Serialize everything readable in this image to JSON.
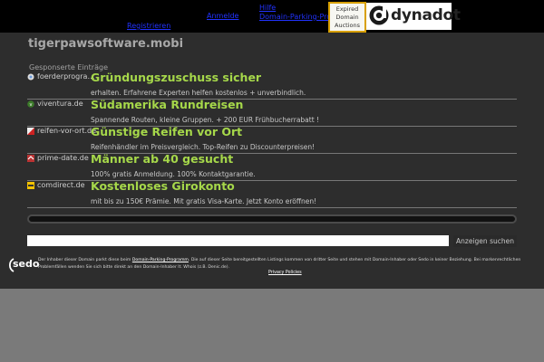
{
  "top": {
    "links": [
      "Registrieren",
      "Anmelde",
      "Hilfe",
      "Domain-Parking-Programm"
    ],
    "expired_box": {
      "line1": "Expired",
      "line2": "Domain",
      "line3": "Auctions"
    },
    "dynadot_text": "dynadot"
  },
  "main": {
    "domain": "tigerpawsoftware.mobi",
    "sponsored_label": "Gesponserte Einträge",
    "ads": [
      {
        "site": "foerderprogramme.net",
        "title": "Gründungszuschuss sicher",
        "desc": "erhalten. Erfahrene Experten helfen kostenlos + unverbindlich."
      },
      {
        "site": "viventura.de",
        "title": "Südamerika Rundreisen",
        "desc": "Spannende Routen, kleine Gruppen. + 200 EUR Frühbucherrabatt !"
      },
      {
        "site": "reifen-vor-ort.de",
        "title": "Günstige Reifen vor Ort",
        "desc": "Reifenhändler im Preisvergleich. Top-Reifen zu Discounterpreisen!"
      },
      {
        "site": "prime-date.de",
        "title": "Männer ab 40 gesucht",
        "desc": "100% gratis Anmeldung. 100% Kontaktgarantie."
      },
      {
        "site": "comdirect.de",
        "title": "Kostenloses Girokonto",
        "desc": "mit bis zu 150€ Prämie. Mit gratis Visa-Karte. Jetzt Konto eröffnen!"
      }
    ],
    "search": {
      "value": "",
      "button_label": "Anzeigen suchen"
    }
  },
  "footer": {
    "sedo_logo": "sedo",
    "disclaimer_pre": "Der Inhaber dieser Domain parkt diese beim ",
    "disclaimer_link": "Domain-Parking-Programm",
    "disclaimer_post": ". Die auf dieser Seite bereitgestellten Listings kommen von dritter Seite und stehen mit Domain-Inhaber oder Sedo in keiner Beziehung. Bei markenrechtlichen Problemfällen wenden Sie sich bitte direkt an den Domain-Inhaber lt. Whois (z.B. Denic.de).",
    "privacy_label": "Privacy Policies"
  },
  "colors": {
    "ad_title": "#a6d84a",
    "panel": "#2d2d2d",
    "page_bg": "#7a7a7a",
    "top_link": "#2233ff",
    "expired_border": "#d8a000"
  }
}
